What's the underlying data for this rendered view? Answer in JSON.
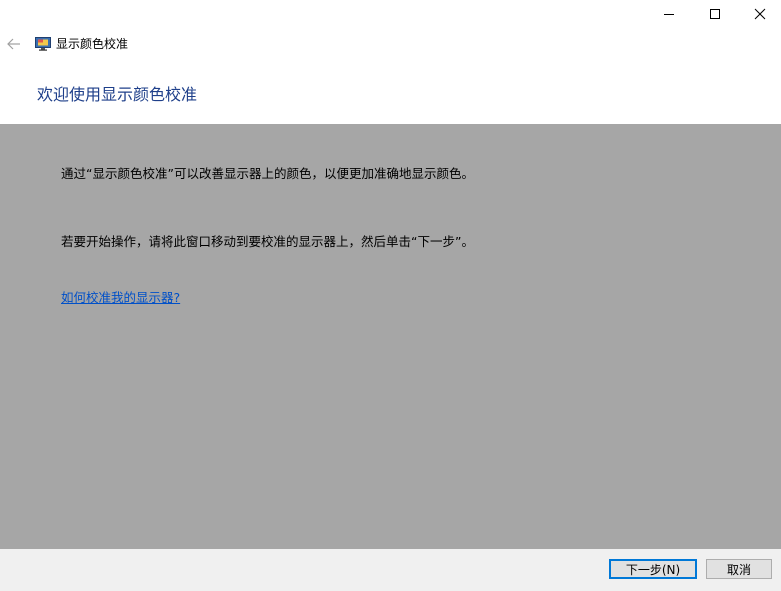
{
  "window": {
    "title": "显示颜色校准"
  },
  "page": {
    "heading": "欢迎使用显示颜色校准",
    "paragraph1": "通过“显示颜色校准”可以改善显示器上的颜色，以便更加准确地显示颜色。",
    "paragraph2": "若要开始操作，请将此窗口移动到要校准的显示器上，然后单击“下一步”。",
    "help_link": "如何校准我的显示器?"
  },
  "buttons": {
    "next_label": "下一步(N)",
    "cancel_label": "取消"
  },
  "icons": {
    "back": "back-arrow-icon",
    "app": "monitor-icon",
    "minimize": "minimize-icon",
    "maximize": "maximize-icon",
    "close": "close-icon"
  },
  "colors": {
    "heading": "#1e3f8a",
    "link": "#0050c8",
    "content_bg": "#a6a6a6",
    "accent": "#0078d7"
  }
}
